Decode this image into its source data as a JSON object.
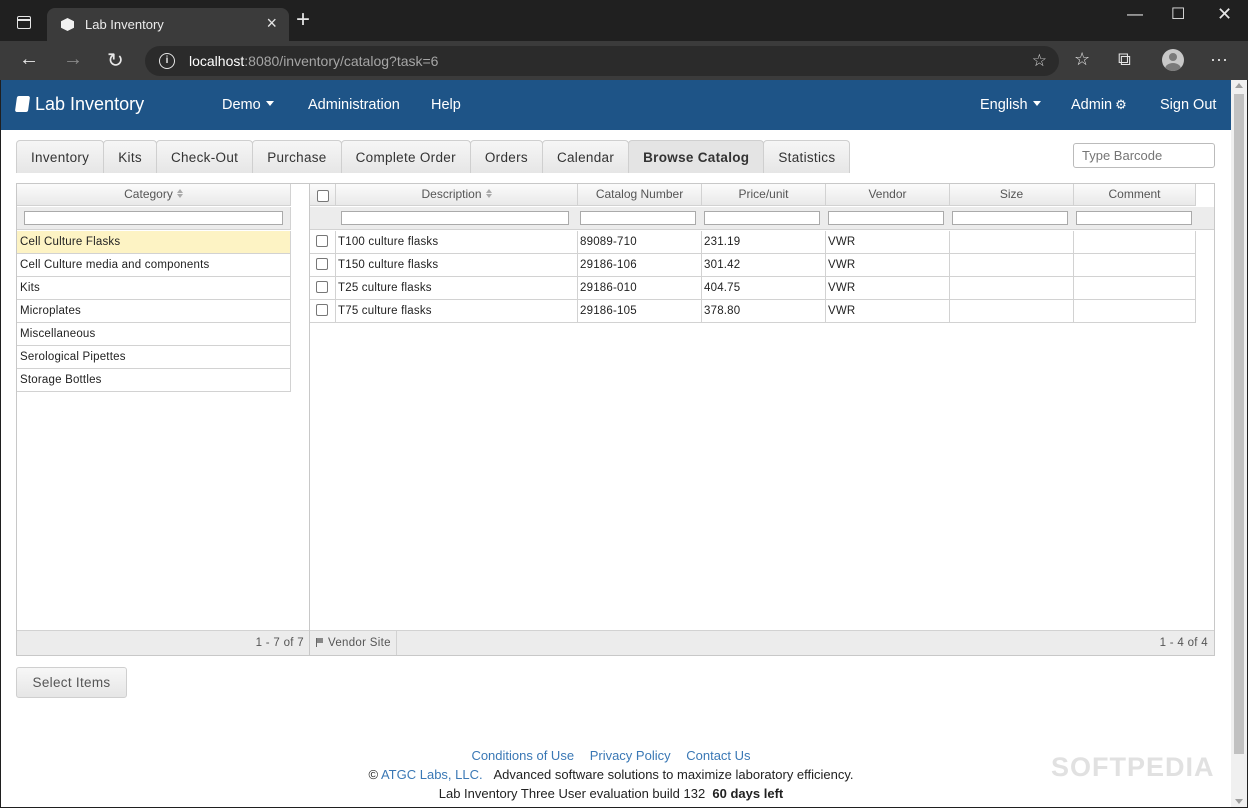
{
  "browser": {
    "tab_title": "Lab Inventory",
    "url_host": "localhost",
    "url_rest": ":8080/inventory/catalog?task=6"
  },
  "app": {
    "brand": "Lab Inventory",
    "nav": {
      "demo": "Demo",
      "administration": "Administration",
      "help": "Help",
      "language": "English",
      "admin": "Admin",
      "signout": "Sign Out"
    }
  },
  "tabs": [
    "Inventory",
    "Kits",
    "Check-Out",
    "Purchase",
    "Complete Order",
    "Orders",
    "Calendar",
    "Browse Catalog",
    "Statistics"
  ],
  "active_tab": "Browse Catalog",
  "barcode_placeholder": "Type Barcode",
  "category": {
    "header": "Category",
    "items": [
      "Cell Culture Flasks",
      "Cell Culture media and components",
      "Kits",
      "Microplates",
      "Miscellaneous",
      "Serological Pipettes",
      "Storage Bottles"
    ],
    "selected": "Cell Culture Flasks",
    "pager": "1 - 7 of 7"
  },
  "items": {
    "columns": [
      "Description",
      "Catalog Number",
      "Price/unit",
      "Vendor",
      "Size",
      "Comment"
    ],
    "rows": [
      [
        "T100 culture flasks",
        "89089-710",
        "231.19",
        "VWR",
        "",
        ""
      ],
      [
        "T150 culture flasks",
        "29186-106",
        "301.42",
        "VWR",
        "",
        ""
      ],
      [
        "T25 culture flasks",
        "29186-010",
        "404.75",
        "VWR",
        "",
        ""
      ],
      [
        "T75 culture flasks",
        "29186-105",
        "378.80",
        "VWR",
        "",
        ""
      ]
    ],
    "vendor_site": "Vendor Site",
    "pager": "1 - 4 of 4"
  },
  "select_items_label": "Select Items",
  "footer": {
    "links": [
      "Conditions of Use",
      "Privacy Policy",
      "Contact Us"
    ],
    "copyright_symbol": "©",
    "company": "ATGC Labs, LLC.",
    "tagline": "Advanced software solutions to maximize laboratory efficiency.",
    "build": "Lab Inventory Three User evaluation build 132",
    "days_left": "60 days left"
  },
  "watermark": "SOFTPEDIA",
  "colors": {
    "appbar": "#1e5487",
    "selected_row": "#fdf3c4",
    "link": "#3a78b5"
  }
}
